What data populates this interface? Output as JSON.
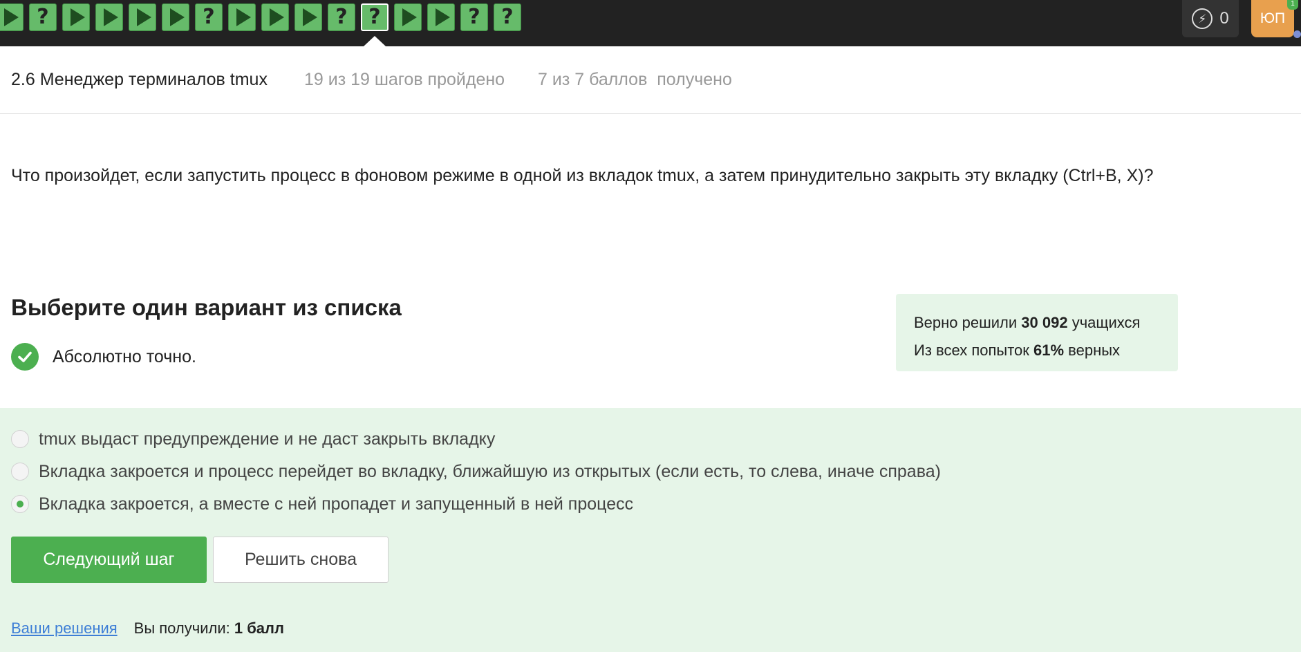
{
  "steps": [
    {
      "type": "play"
    },
    {
      "type": "question"
    },
    {
      "type": "play"
    },
    {
      "type": "play"
    },
    {
      "type": "play"
    },
    {
      "type": "play"
    },
    {
      "type": "question"
    },
    {
      "type": "play"
    },
    {
      "type": "play"
    },
    {
      "type": "play"
    },
    {
      "type": "question"
    },
    {
      "type": "question",
      "current": true
    },
    {
      "type": "play"
    },
    {
      "type": "play"
    },
    {
      "type": "question"
    },
    {
      "type": "question"
    }
  ],
  "step_glyph_question": "?",
  "header": {
    "energy_count": "0",
    "avatar_initials": "ЮП",
    "avatar_badge": "1",
    "lesson_title": "2.6 Менеджер терминалов tmux",
    "lesson_steps": "19 из 19 шагов пройдено",
    "lesson_score": "7 из 7 баллов  получено"
  },
  "question_text": "Что произойдет, если запустить процесс в фоновом режиме в одной из вкладок tmux, а затем принудительно закрыть эту вкладку (Ctrl+B, X)?",
  "choose_title": "Выберите один вариант из списка",
  "correct_message": "Абсолютно точно.",
  "stats": {
    "line1_pre": "Верно решили ",
    "line1_num": "30 092",
    "line1_post": " учащихся",
    "line2_pre": "Из всех попыток ",
    "line2_num": "61%",
    "line2_post": " верных"
  },
  "options": [
    {
      "label": "tmux выдаст предупреждение и не даст закрыть вкладку",
      "selected": false
    },
    {
      "label": "Вкладка закроется и процесс перейдет во вкладку, ближайшую из открытых (если есть, то слева, иначе справа)",
      "selected": false
    },
    {
      "label": "Вкладка закроется, а вместе с ней пропадет и запущенный в ней процесс",
      "selected": true
    }
  ],
  "buttons": {
    "next": "Следующий шаг",
    "retry": "Решить снова"
  },
  "footer": {
    "solutions_link": "Ваши решения",
    "received_label": "Вы получили: ",
    "received_value": "1 балл"
  },
  "colors": {
    "accent_green": "#4caf50",
    "step_green": "#66bb6a",
    "topbar": "#222222",
    "answers_bg": "#e6f5e8",
    "avatar": "#e8a04e"
  }
}
